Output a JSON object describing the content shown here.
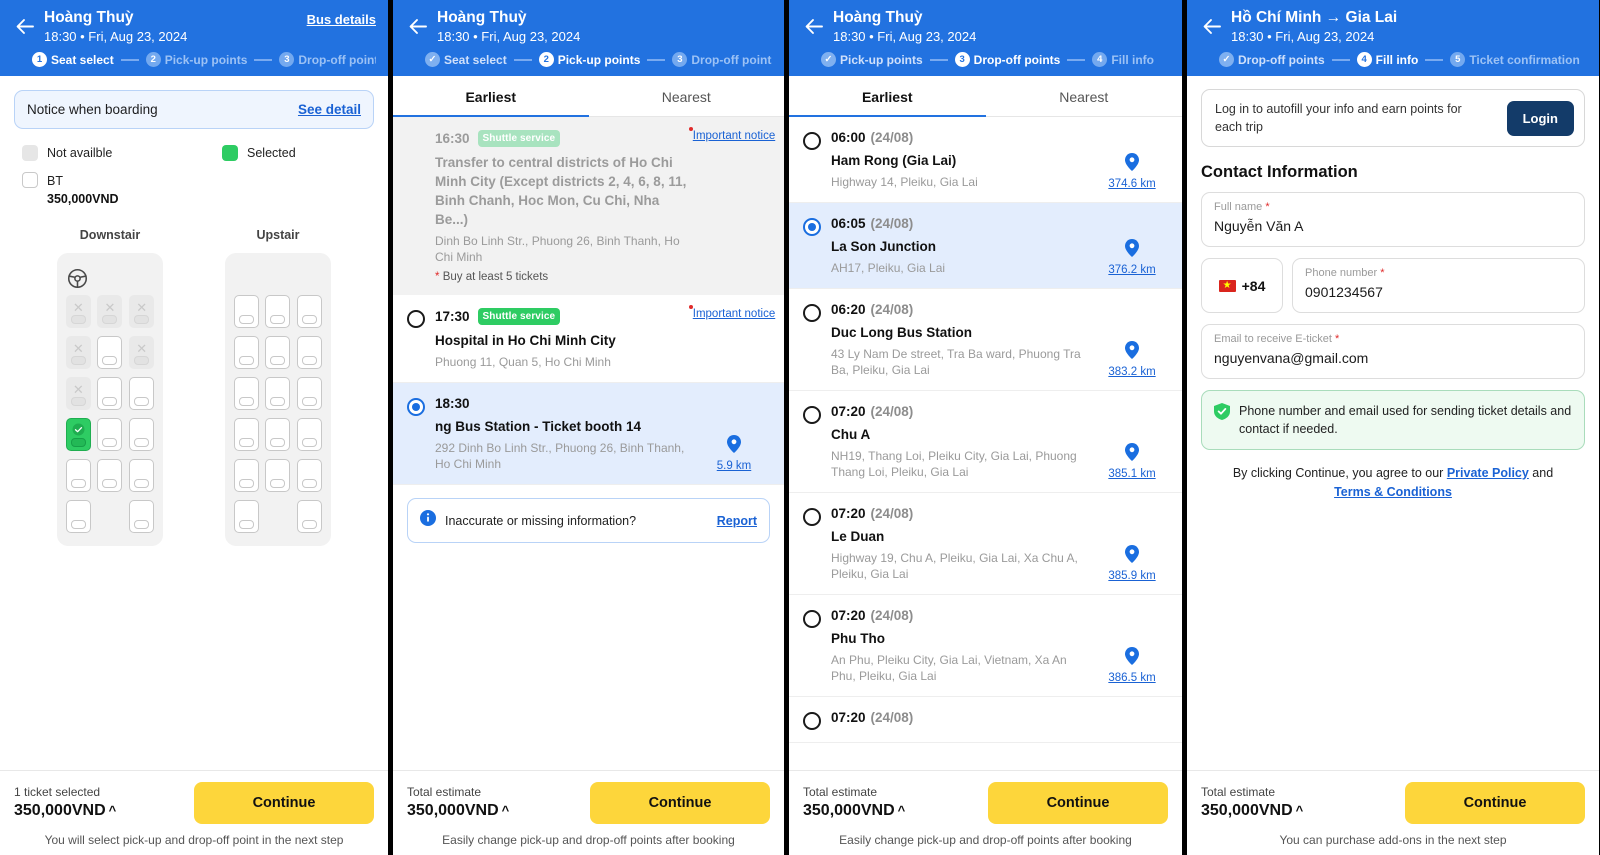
{
  "colors": {
    "brand_blue": "#2272e0",
    "accent_yellow": "#fdd63b",
    "green": "#2ecc63",
    "link_blue": "#1a62d4",
    "navy": "#133b69"
  },
  "panel1": {
    "header": {
      "title": "Hoàng Thuỳ",
      "subtitle": "18:30 • Fri, Aug 23, 2024",
      "action": "Bus details"
    },
    "steps": [
      {
        "num": "1",
        "label": "Seat select",
        "state": "active"
      },
      {
        "num": "2",
        "label": "Pick-up points",
        "state": "todo"
      },
      {
        "num": "3",
        "label": "Drop-off points",
        "state": "todo"
      }
    ],
    "notice": {
      "text": "Notice when boarding",
      "link": "See detail"
    },
    "legend": {
      "not_available": "Not availble",
      "selected": "Selected",
      "bt_label": "BT",
      "bt_price": "350,000VND"
    },
    "decks": [
      {
        "title": "Downstair"
      },
      {
        "title": "Upstair"
      }
    ],
    "bottom": {
      "caption": "1 ticket selected",
      "price": "350,000VND",
      "caret": "^",
      "continue": "Continue",
      "note": "You will select pick-up and drop-off point in the next step"
    }
  },
  "panel2": {
    "header": {
      "title": "Hoàng Thuỳ",
      "subtitle": "18:30 • Fri, Aug 23, 2024"
    },
    "steps": [
      {
        "num": "✓",
        "label": "Seat select",
        "state": "done"
      },
      {
        "num": "2",
        "label": "Pick-up points",
        "state": "active"
      },
      {
        "num": "3",
        "label": "Drop-off points",
        "state": "todo"
      }
    ],
    "tabs": [
      {
        "label": "Earliest",
        "active": true
      },
      {
        "label": "Nearest",
        "active": false
      }
    ],
    "points": [
      {
        "time": "16:30",
        "date": "",
        "badge": "Shuttle service",
        "name": "Transfer to central districts of Ho Chi Minh City (Except districts 2, 4, 6, 8, 11, Binh Chanh, Hoc Mon, Cu Chi, Nha Be...)",
        "address": "Dinh Bo Linh Str., Phuong 26, Binh Thanh, Ho Chi Minh",
        "note": "Buy at least 5 tickets",
        "important": "Important notice",
        "state": "disabled"
      },
      {
        "time": "17:30",
        "date": "",
        "badge": "Shuttle service",
        "name": "Hospital in Ho Chi Minh City",
        "address": "Phuong 11, Quan 5, Ho Chi Minh",
        "important": "Important notice",
        "state": "normal"
      },
      {
        "time": "18:30",
        "date": "",
        "name": "ng Bus Station - Ticket booth 14",
        "address": "292 Dinh Bo Linh Str., Phuong 26, Binh Thanh, Ho Chi Minh",
        "distance": "5.9 km",
        "state": "selected"
      }
    ],
    "report": {
      "text": "Inaccurate or missing information?",
      "link": "Report"
    },
    "bottom": {
      "caption": "Total estimate",
      "price": "350,000VND",
      "caret": "^",
      "continue": "Continue",
      "note": "Easily change pick-up and drop-off points after booking"
    }
  },
  "panel3": {
    "header": {
      "title": "Hoàng Thuỳ",
      "subtitle": "18:30 • Fri, Aug 23, 2024"
    },
    "steps": [
      {
        "num": "✓",
        "label": "Pick-up points",
        "state": "done"
      },
      {
        "num": "3",
        "label": "Drop-off points",
        "state": "active"
      },
      {
        "num": "4",
        "label": "Fill info",
        "state": "todo"
      }
    ],
    "tabs": [
      {
        "label": "Earliest",
        "active": true
      },
      {
        "label": "Nearest",
        "active": false
      }
    ],
    "points": [
      {
        "time": "06:00",
        "date": "(24/08)",
        "name": "Ham Rong (Gia Lai)",
        "address": "Highway 14, Pleiku, Gia Lai",
        "distance": "374.6 km",
        "state": "normal"
      },
      {
        "time": "06:05",
        "date": "(24/08)",
        "name": "La Son Junction",
        "address": "AH17, Pleiku, Gia Lai",
        "distance": "376.2 km",
        "state": "selected"
      },
      {
        "time": "06:20",
        "date": "(24/08)",
        "name": "Duc Long Bus Station",
        "address": "43 Ly Nam De street, Tra Ba ward, Phuong Tra Ba, Pleiku, Gia Lai",
        "distance": "383.2 km",
        "state": "normal"
      },
      {
        "time": "07:20",
        "date": "(24/08)",
        "name": "Chu A",
        "address": "NH19, Thang Loi, Pleiku City, Gia Lai, Phuong Thang Loi, Pleiku, Gia Lai",
        "distance": "385.1 km",
        "state": "normal"
      },
      {
        "time": "07:20",
        "date": "(24/08)",
        "name": "Le Duan",
        "address": "Highway 19, Chu A, Pleiku, Gia Lai, Xa Chu A, Pleiku, Gia Lai",
        "distance": "385.9 km",
        "state": "normal"
      },
      {
        "time": "07:20",
        "date": "(24/08)",
        "name": "Phu Tho",
        "address": "An Phu, Pleiku City, Gia Lai, Vietnam, Xa An Phu, Pleiku, Gia Lai",
        "distance": "386.5 km",
        "state": "normal"
      },
      {
        "time": "07:20",
        "date": "(24/08)",
        "name": "",
        "address": "",
        "distance": "",
        "state": "normal"
      }
    ],
    "bottom": {
      "caption": "Total estimate",
      "price": "350,000VND",
      "caret": "^",
      "continue": "Continue",
      "note": "Easily change pick-up and drop-off points after booking"
    }
  },
  "panel4": {
    "header": {
      "title": "Hồ Chí Minh → Gia Lai",
      "subtitle": "18:30 • Fri, Aug 23, 2024"
    },
    "steps": [
      {
        "num": "✓",
        "label": "Drop-off points",
        "state": "done"
      },
      {
        "num": "4",
        "label": "Fill info",
        "state": "active"
      },
      {
        "num": "5",
        "label": "Ticket confirmation",
        "state": "todo"
      }
    ],
    "login": {
      "text": "Log in to autofill your info and earn points for each trip",
      "button": "Login"
    },
    "section_title": "Contact Information",
    "fields": {
      "fullname_label": "Full name",
      "fullname_value": "Nguyễn Văn A",
      "country_code": "+84",
      "phone_label": "Phone number",
      "phone_value": "0901234567",
      "email_label": "Email to receive E-ticket",
      "email_value": "nguyenvana@gmail.com",
      "required_mark": "*"
    },
    "green_note": "Phone number and email used for sending ticket details and contact if needed.",
    "terms": {
      "prefix": "By clicking Continue, you agree to our ",
      "link1": "Private Policy",
      "middle": " and ",
      "link2": "Terms & Conditions"
    },
    "bottom": {
      "caption": "Total estimate",
      "price": "350,000VND",
      "caret": "^",
      "continue": "Continue",
      "note": "You can purchase add-ons in the next step"
    }
  }
}
